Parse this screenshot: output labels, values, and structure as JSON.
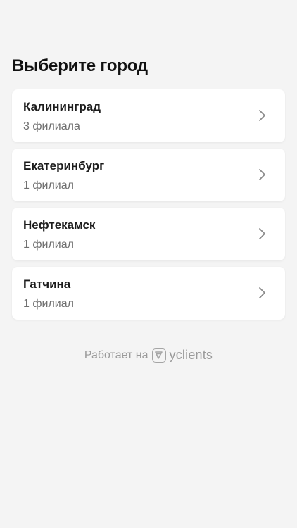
{
  "header": {
    "title": "Выберите город"
  },
  "cities": [
    {
      "name": "Калининград",
      "count": "3 филиала"
    },
    {
      "name": "Екатеринбург",
      "count": "1 филиал"
    },
    {
      "name": "Нефтекамск",
      "count": "1 филиал"
    },
    {
      "name": "Гатчина",
      "count": "1 филиал"
    }
  ],
  "footer": {
    "powered_by": "Работает на",
    "brand": "yclients"
  },
  "icons": {
    "chevron": "chevron-right-icon",
    "brand_logo": "yclients-logo-icon"
  },
  "colors": {
    "background": "#f4f4f4",
    "card": "#ffffff",
    "title": "#111111",
    "secondary_text": "#6f6f6f",
    "footer_text": "#9a9a9a"
  }
}
